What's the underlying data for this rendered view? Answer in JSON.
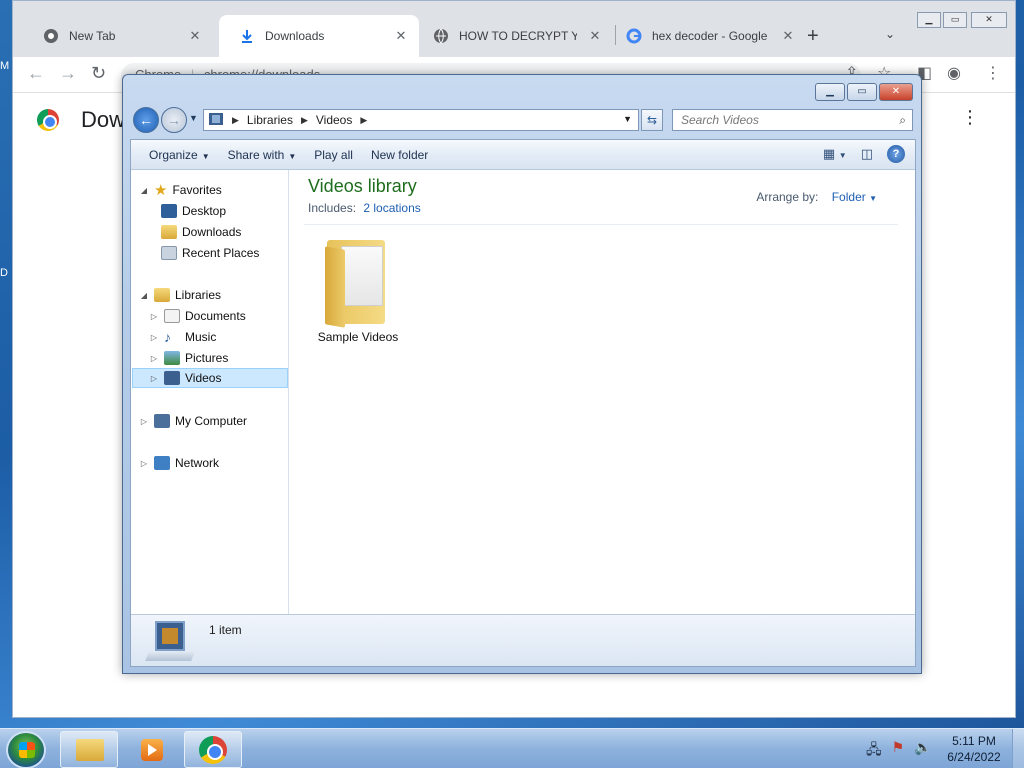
{
  "desktop": {
    "edge_letter_top": "M",
    "edge_letter_mid": "D"
  },
  "chrome": {
    "tabs": [
      {
        "title": "New Tab",
        "icon": "chrome-icon",
        "active": false
      },
      {
        "title": "Downloads",
        "icon": "download-icon",
        "active": true
      },
      {
        "title": "HOW TO DECRYPT YOU",
        "icon": "globe-icon",
        "active": false
      },
      {
        "title": "hex decoder - Google S",
        "icon": "google-icon",
        "active": false
      }
    ],
    "new_tab_glyph": "+",
    "omnibox_site": "Chrome",
    "omnibox_url": "chrome://downloads",
    "page_heading": "Dow"
  },
  "explorer": {
    "breadcrumb": [
      "Libraries",
      "Videos"
    ],
    "search_placeholder": "Search Videos",
    "commands": {
      "organize": "Organize",
      "share_with": "Share with",
      "play_all": "Play all",
      "new_folder": "New folder"
    },
    "nav": {
      "favorites": "Favorites",
      "desktop": "Desktop",
      "downloads": "Downloads",
      "recent_places": "Recent Places",
      "libraries": "Libraries",
      "documents": "Documents",
      "music": "Music",
      "pictures": "Pictures",
      "videos": "Videos",
      "my_computer": "My Computer",
      "network": "Network"
    },
    "library_title": "Videos library",
    "includes_label": "Includes:",
    "includes_link": "2 locations",
    "arrange_label": "Arrange by:",
    "arrange_value": "Folder",
    "items": [
      {
        "name": "Sample Videos",
        "type": "folder"
      }
    ],
    "item_count": "1 item"
  },
  "taskbar": {
    "time": "5:11 PM",
    "date": "6/24/2022",
    "pinned": [
      "explorer-icon",
      "media-player-icon",
      "chrome-icon"
    ]
  },
  "colors": {
    "library_title": "#1e6e1e",
    "link": "#1f5fb4",
    "selection": "#cce8ff"
  }
}
